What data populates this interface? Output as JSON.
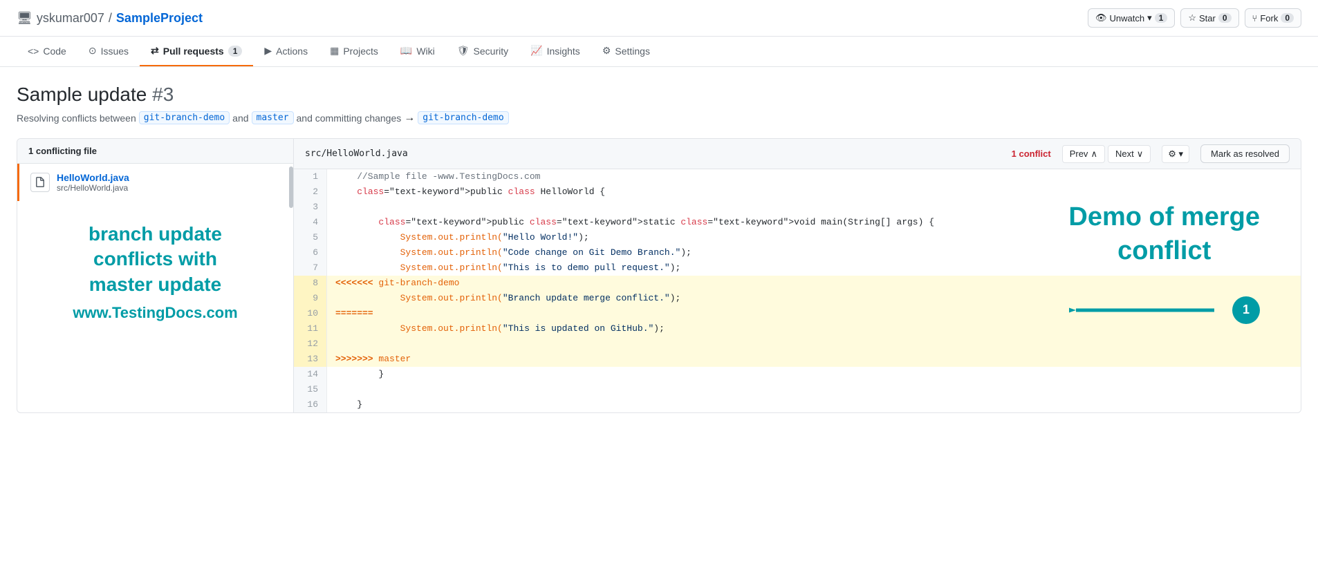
{
  "repo": {
    "owner": "yskumar007",
    "separator": "/",
    "name": "SampleProject",
    "unwatch_label": "Unwatch",
    "unwatch_count": "1",
    "star_label": "Star",
    "star_count": "0",
    "fork_label": "Fork",
    "fork_count": "0"
  },
  "nav": {
    "tabs": [
      {
        "id": "code",
        "label": "Code",
        "icon": "<>",
        "active": false,
        "badge": null
      },
      {
        "id": "issues",
        "label": "Issues",
        "icon": "ⓘ",
        "active": false,
        "badge": null
      },
      {
        "id": "pull-requests",
        "label": "Pull requests",
        "icon": "⇄",
        "active": true,
        "badge": "1"
      },
      {
        "id": "actions",
        "label": "Actions",
        "icon": "▶",
        "active": false,
        "badge": null
      },
      {
        "id": "projects",
        "label": "Projects",
        "icon": "⊞",
        "active": false,
        "badge": null
      },
      {
        "id": "wiki",
        "label": "Wiki",
        "icon": "📖",
        "active": false,
        "badge": null
      },
      {
        "id": "security",
        "label": "Security",
        "icon": "🛡",
        "active": false,
        "badge": null
      },
      {
        "id": "insights",
        "label": "Insights",
        "icon": "📈",
        "active": false,
        "badge": null
      },
      {
        "id": "settings",
        "label": "Settings",
        "icon": "⚙",
        "active": false,
        "badge": null
      }
    ]
  },
  "pr": {
    "title": "Sample update",
    "number": "#3",
    "subtitle_text": "Resolving conflicts between",
    "branch_from": "git-branch-demo",
    "and_text": "and",
    "branch_to": "master",
    "and_committing": "and committing changes",
    "arrow": "→",
    "branch_dest": "git-branch-demo"
  },
  "conflict_editor": {
    "sidebar_header": "1 conflicting file",
    "file_name": "HelloWorld.java",
    "file_path": "src/HelloWorld.java",
    "editor_path": "src/HelloWorld.java",
    "conflict_count": "1 conflict",
    "prev_label": "Prev",
    "next_label": "Next",
    "mark_resolved_label": "Mark as resolved"
  },
  "sidebar_overlay": {
    "line1": "branch update",
    "line2": "conflicts with",
    "line3": "master update",
    "site": "www.TestingDocs.com"
  },
  "demo_overlay": {
    "line1": "Demo of merge",
    "line2": "conflict"
  },
  "code_lines": [
    {
      "num": 1,
      "content": "    //Sample file -www.TestingDocs.com",
      "style": "comment",
      "conflict": false
    },
    {
      "num": 2,
      "content": "    public class HelloWorld {",
      "style": "normal",
      "conflict": false
    },
    {
      "num": 3,
      "content": "",
      "style": "normal",
      "conflict": false
    },
    {
      "num": 4,
      "content": "        public static void main(String[] args) {",
      "style": "normal",
      "conflict": false
    },
    {
      "num": 5,
      "content": "            System.out.println(\"Hello World!\");",
      "style": "normal",
      "conflict": false
    },
    {
      "num": 6,
      "content": "            System.out.println(\"Code change on Git Demo Branch.\");",
      "style": "normal",
      "conflict": false
    },
    {
      "num": 7,
      "content": "            System.out.println(\"This is to demo pull request.\");",
      "style": "normal",
      "conflict": false
    },
    {
      "num": 8,
      "content": "<<<<<<< git-branch-demo",
      "style": "conflict-marker",
      "conflict": true
    },
    {
      "num": 9,
      "content": "            System.out.println(\"Branch update merge conflict.\");",
      "style": "normal",
      "conflict": true
    },
    {
      "num": 10,
      "content": "=======",
      "style": "conflict-divider",
      "conflict": true
    },
    {
      "num": 11,
      "content": "            System.out.println(\"This is updated on GitHub.\");",
      "style": "normal",
      "conflict": true
    },
    {
      "num": 12,
      "content": "",
      "style": "normal",
      "conflict": true
    },
    {
      "num": 13,
      "content": ">>>>>>> master",
      "style": "conflict-marker",
      "conflict": true
    },
    {
      "num": 14,
      "content": "        }",
      "style": "normal",
      "conflict": false
    },
    {
      "num": 15,
      "content": "",
      "style": "normal",
      "conflict": false
    },
    {
      "num": 16,
      "content": "    }",
      "style": "normal",
      "conflict": false
    }
  ]
}
